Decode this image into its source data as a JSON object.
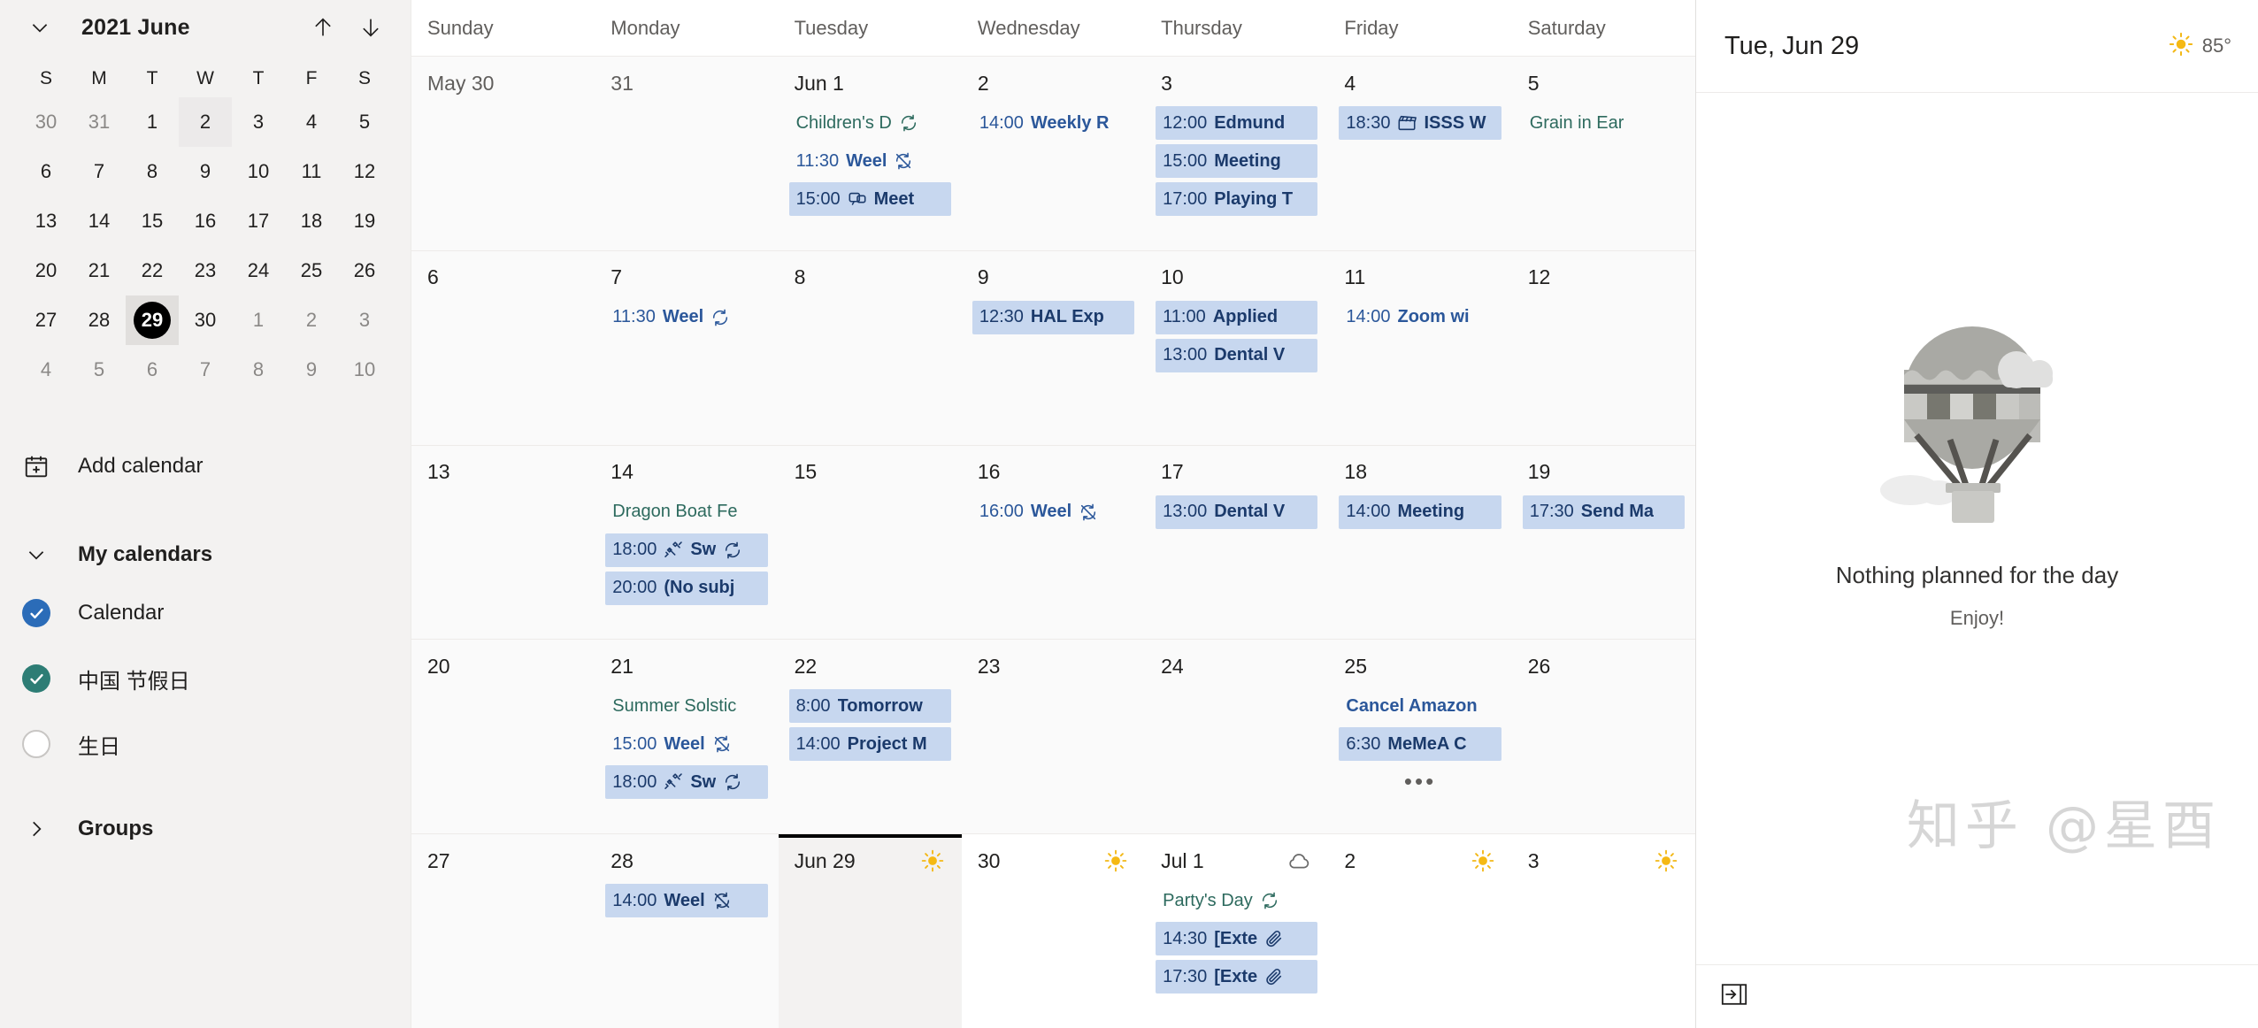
{
  "sidebar": {
    "mini_calendar": {
      "collapse_icon": "chevron-down-icon",
      "title": "2021 June",
      "prev_icon": "arrow-up-icon",
      "next_icon": "arrow-down-icon",
      "dow": [
        "S",
        "M",
        "T",
        "W",
        "T",
        "F",
        "S"
      ],
      "weeks": [
        [
          {
            "n": "30",
            "muted": true
          },
          {
            "n": "31",
            "muted": true
          },
          {
            "n": "1",
            "muted": false
          },
          {
            "n": "2",
            "muted": false,
            "hover": true
          },
          {
            "n": "3",
            "muted": false
          },
          {
            "n": "4",
            "muted": false
          },
          {
            "n": "5",
            "muted": false
          }
        ],
        [
          {
            "n": "6"
          },
          {
            "n": "7"
          },
          {
            "n": "8"
          },
          {
            "n": "9"
          },
          {
            "n": "10"
          },
          {
            "n": "11"
          },
          {
            "n": "12"
          }
        ],
        [
          {
            "n": "13"
          },
          {
            "n": "14"
          },
          {
            "n": "15"
          },
          {
            "n": "16"
          },
          {
            "n": "17"
          },
          {
            "n": "18"
          },
          {
            "n": "19"
          }
        ],
        [
          {
            "n": "20"
          },
          {
            "n": "21"
          },
          {
            "n": "22"
          },
          {
            "n": "23"
          },
          {
            "n": "24"
          },
          {
            "n": "25"
          },
          {
            "n": "26"
          }
        ],
        [
          {
            "n": "27"
          },
          {
            "n": "28"
          },
          {
            "n": "29",
            "today": true
          },
          {
            "n": "30"
          },
          {
            "n": "1",
            "muted": true
          },
          {
            "n": "2",
            "muted": true
          },
          {
            "n": "3",
            "muted": true
          }
        ],
        [
          {
            "n": "4",
            "muted": true
          },
          {
            "n": "5",
            "muted": true
          },
          {
            "n": "6",
            "muted": true
          },
          {
            "n": "7",
            "muted": true
          },
          {
            "n": "8",
            "muted": true
          },
          {
            "n": "9",
            "muted": true
          },
          {
            "n": "10",
            "muted": true
          }
        ]
      ]
    },
    "add_calendar": {
      "icon": "calendar-plus-icon",
      "label": "Add calendar"
    },
    "my_calendars": {
      "icon": "chevron-down-icon",
      "label": "My calendars",
      "items": [
        {
          "label": "Calendar",
          "checked": true,
          "color": "#2b6cb8",
          "icon": "checkbox-checked-icon"
        },
        {
          "label": "中国 节假日",
          "checked": true,
          "color": "#2d7d75",
          "icon": "checkbox-checked-icon"
        },
        {
          "label": "生日",
          "checked": false,
          "color": "#ffffff",
          "icon": "checkbox-unchecked-icon"
        }
      ]
    },
    "groups": {
      "icon": "chevron-right-icon",
      "label": "Groups"
    }
  },
  "grid": {
    "day_headers": [
      "Sunday",
      "Monday",
      "Tuesday",
      "Wednesday",
      "Thursday",
      "Friday",
      "Saturday"
    ],
    "weeks": [
      {
        "days": [
          {
            "label": "May 30",
            "muted": true,
            "events": []
          },
          {
            "label": "31",
            "muted": true,
            "events": []
          },
          {
            "label": "Jun 1",
            "events": [
              {
                "style": "holiday",
                "time": "",
                "title": "Children's D",
                "icon": "recurring-icon"
              },
              {
                "style": "plain",
                "time": "11:30",
                "title": "Weel",
                "icon": "recurring-exception-icon"
              },
              {
                "style": "chip",
                "time": "15:00",
                "title": "Meet",
                "icon": "teams-icon",
                "icon_before_title": true
              }
            ]
          },
          {
            "label": "2",
            "events": [
              {
                "style": "plain",
                "time": "14:00",
                "title": "Weekly R"
              }
            ]
          },
          {
            "label": "3",
            "events": [
              {
                "style": "chip",
                "time": "12:00",
                "title": "Edmund"
              },
              {
                "style": "chip",
                "time": "15:00",
                "title": "Meeting"
              },
              {
                "style": "chip",
                "time": "17:00",
                "title": "Playing T"
              }
            ]
          },
          {
            "label": "4",
            "events": [
              {
                "style": "chip",
                "time": "18:30",
                "title": "ISSS W",
                "icon": "clapperboard-icon",
                "icon_before_title": true
              }
            ]
          },
          {
            "label": "5",
            "events": [
              {
                "style": "holiday",
                "time": "",
                "title": "Grain in Ear"
              }
            ]
          }
        ]
      },
      {
        "days": [
          {
            "label": "6",
            "events": []
          },
          {
            "label": "7",
            "events": [
              {
                "style": "plain",
                "time": "11:30",
                "title": "Weel",
                "icon": "recurring-icon"
              }
            ]
          },
          {
            "label": "8",
            "events": []
          },
          {
            "label": "9",
            "events": [
              {
                "style": "chip",
                "time": "12:30",
                "title": "HAL Exp"
              }
            ]
          },
          {
            "label": "10",
            "events": [
              {
                "style": "chip",
                "time": "11:00",
                "title": "Applied"
              },
              {
                "style": "chip",
                "time": "13:00",
                "title": "Dental V"
              }
            ]
          },
          {
            "label": "11",
            "events": [
              {
                "style": "plain",
                "time": "14:00",
                "title": "Zoom wi"
              }
            ]
          },
          {
            "label": "12",
            "events": []
          }
        ]
      },
      {
        "days": [
          {
            "label": "13",
            "events": []
          },
          {
            "label": "14",
            "events": [
              {
                "style": "holiday",
                "time": "",
                "title": "Dragon Boat Fe"
              },
              {
                "style": "chip",
                "time": "18:00",
                "title": "Sw",
                "icon": "dumbbell-icon",
                "icon_before_title": true,
                "icon2": "recurring-icon"
              },
              {
                "style": "chip",
                "time": "20:00",
                "title": "(No subj"
              }
            ]
          },
          {
            "label": "15",
            "events": []
          },
          {
            "label": "16",
            "events": [
              {
                "style": "plain",
                "time": "16:00",
                "title": "Weel",
                "icon": "recurring-exception-icon"
              }
            ]
          },
          {
            "label": "17",
            "events": [
              {
                "style": "chip",
                "time": "13:00",
                "title": "Dental V"
              }
            ]
          },
          {
            "label": "18",
            "events": [
              {
                "style": "chip",
                "time": "14:00",
                "title": "Meeting"
              }
            ]
          },
          {
            "label": "19",
            "events": [
              {
                "style": "chip",
                "time": "17:30",
                "title": "Send Ma"
              }
            ]
          }
        ]
      },
      {
        "days": [
          {
            "label": "20",
            "events": []
          },
          {
            "label": "21",
            "events": [
              {
                "style": "holiday",
                "time": "",
                "title": "Summer Solstic"
              },
              {
                "style": "plain",
                "time": "15:00",
                "title": "Weel",
                "icon": "recurring-exception-icon"
              },
              {
                "style": "chip",
                "time": "18:00",
                "title": "Sw",
                "icon": "dumbbell-icon",
                "icon_before_title": true,
                "icon2": "recurring-icon"
              }
            ]
          },
          {
            "label": "22",
            "events": [
              {
                "style": "chip",
                "time": "8:00",
                "title": "Tomorrow"
              },
              {
                "style": "chip",
                "time": "14:00",
                "title": "Project M"
              }
            ]
          },
          {
            "label": "23",
            "events": []
          },
          {
            "label": "24",
            "events": []
          },
          {
            "label": "25",
            "events": [
              {
                "style": "plain",
                "time": "",
                "title": "Cancel Amazon"
              },
              {
                "style": "chip",
                "time": "6:30",
                "title": "MeMeA C"
              }
            ],
            "more": "•••"
          },
          {
            "label": "26",
            "events": []
          }
        ]
      },
      {
        "days": [
          {
            "label": "27",
            "events": []
          },
          {
            "label": "28",
            "events": [
              {
                "style": "chip",
                "time": "14:00",
                "title": "Weel",
                "icon": "recurring-exception-icon"
              }
            ]
          },
          {
            "label": "Jun 29",
            "selected": true,
            "weather": "sunny-icon",
            "events": []
          },
          {
            "label": "30",
            "future": true,
            "weather": "sunny-icon",
            "events": []
          },
          {
            "label": "Jul 1",
            "future": true,
            "weather": "cloudy-icon",
            "events": [
              {
                "style": "holiday",
                "time": "",
                "title": "Party's Day",
                "icon": "recurring-icon"
              },
              {
                "style": "chip",
                "time": "14:30",
                "title": "[Exte",
                "icon": "attachment-icon"
              },
              {
                "style": "chip",
                "time": "17:30",
                "title": "[Exte",
                "icon": "attachment-icon"
              }
            ]
          },
          {
            "label": "2",
            "future": true,
            "weather": "sunny-icon",
            "events": []
          },
          {
            "label": "3",
            "future": true,
            "weather": "sunny-icon",
            "events": []
          }
        ]
      }
    ]
  },
  "right_panel": {
    "date": "Tue, Jun 29",
    "weather": {
      "icon": "sunny-icon",
      "temperature": "85°"
    },
    "empty_state": {
      "illustration": "hot-air-balloon-icon",
      "title": "Nothing planned for the day",
      "subtitle": "Enjoy!"
    },
    "watermark": "知乎 @星酉",
    "footer_icon": "expand-pane-icon"
  },
  "colors": {
    "sidebar_bg": "#f3f2f1",
    "event_chip_bg": "#c7d7ef",
    "event_text": "#2b579a",
    "holiday_text": "#2d6a5e",
    "today_marker": "#000000",
    "calendar_blue": "#2b6cb8",
    "calendar_teal": "#2d7d75",
    "sun_yellow": "#f3b816"
  }
}
